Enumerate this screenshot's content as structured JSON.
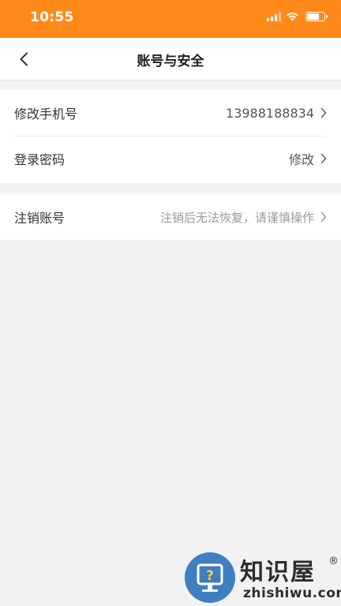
{
  "status_bar": {
    "time": "10:55",
    "battery_level": 0.75,
    "color": "#ff8a1a"
  },
  "nav": {
    "title": "账号与安全",
    "back_icon": "chevron-left-icon"
  },
  "settings": {
    "items": [
      {
        "label": "修改手机号",
        "value": "13988188834"
      },
      {
        "label": "登录密码",
        "value": "修改"
      },
      {
        "label": "注销账号",
        "value": "注销后无法恢复，请谨慎操作"
      }
    ]
  },
  "watermark": {
    "brand": "知识屋",
    "domain": "zhishiwu.com",
    "registered_mark": "®"
  }
}
